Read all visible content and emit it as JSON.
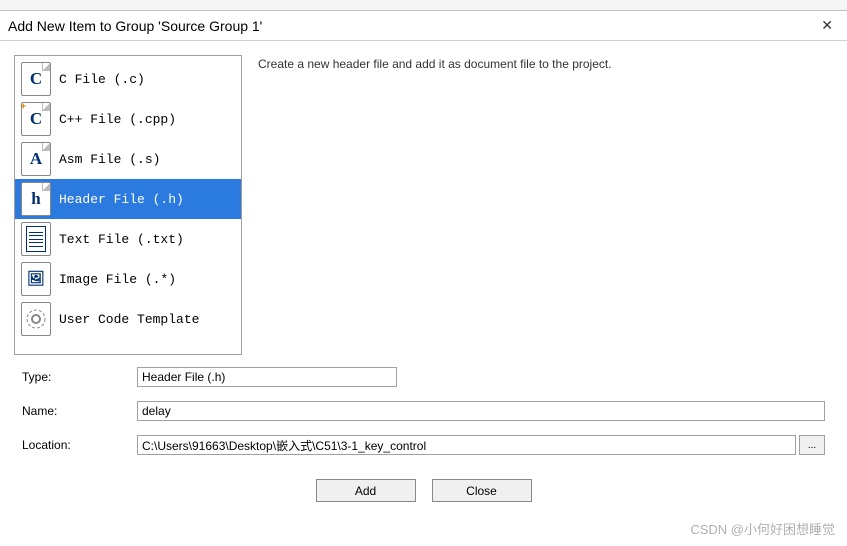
{
  "title": "Add New Item to Group 'Source Group 1'",
  "description": "Create a new header file and add it as document file to the project.",
  "items": [
    {
      "label": "C File (.c)",
      "glyph": "C"
    },
    {
      "label": "C++ File (.cpp)",
      "glyph": "C"
    },
    {
      "label": "Asm File (.s)",
      "glyph": "A"
    },
    {
      "label": "Header File (.h)",
      "glyph": "h"
    },
    {
      "label": "Text File (.txt)",
      "glyph": "lines"
    },
    {
      "label": "Image File (.*)",
      "glyph": "img"
    },
    {
      "label": "User Code Template",
      "glyph": "gear"
    }
  ],
  "selected_index": 3,
  "form": {
    "type_label": "Type:",
    "type_value": "Header File (.h)",
    "name_label": "Name:",
    "name_value": "delay",
    "location_label": "Location:",
    "location_value": "C:\\Users\\91663\\Desktop\\嵌入式\\C51\\3-1_key_control",
    "browse": "..."
  },
  "buttons": {
    "add": "Add",
    "close": "Close"
  },
  "watermark": "CSDN @小何好困想睡觉"
}
